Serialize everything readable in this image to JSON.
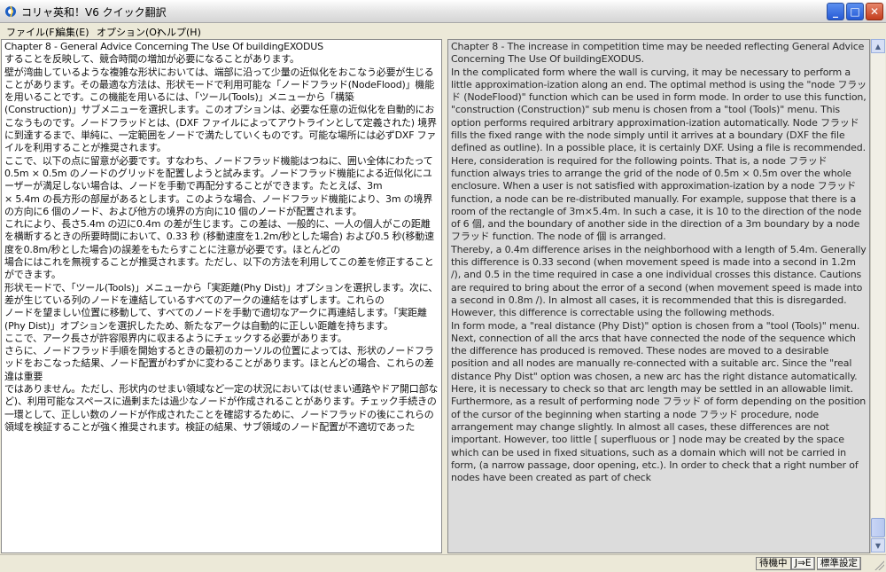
{
  "window": {
    "title": "コリャ英和！V6 クイック翻訳",
    "minimize_label": "_",
    "maximize_label": "□",
    "close_label": "✕"
  },
  "menu": [
    {
      "label": "ファイル(F)"
    },
    {
      "label": "編集(E)"
    },
    {
      "label": "オプション(O)"
    },
    {
      "label": "ヘルプ(H)"
    }
  ],
  "translation_pane": {
    "paragraphs": [
      "Chapter 8 - General Advice Concerning The Use Of buildingEXODUS",
      "することを反映して、競合時間の増加が必要になることがあります。",
      "壁が湾曲しているような複雑な形状においては、端部に沿って少量の近似化をおこなう必要が生じることがあります。その最適な方法は、形状モードで利用可能な「ノードフラッド(NodeFlood)」機能を用いることです。この機能を用いるには、「ツール(Tools)」メニューから「構築",
      "(Construction)」サブメニューを選択します。このオプションは、必要な任意の近似化を自動的におこなうものです。ノードフラッドとは、(DXF ファイルによってアウトラインとして定義された) 境界に到達するまで、単純に、一定範囲をノードで満たしていくものです。可能な場所には必ずDXF ファイルを利用することが推奨されます。",
      "ここで、以下の点に留意が必要です。すなわち、ノードフラッド機能はつねに、囲い全体にわたって0.5m × 0.5m のノードのグリッドを配置しようと試みます。ノードフラッド機能による近似化にユーザーが満足しない場合は、ノードを手動で再配分することができます。たとえば、3m",
      "× 5.4m の長方形の部屋があるとします。このような場合、ノードフラッド機能により、3m の境界の方向に6 個のノード、および他方の境界の方向に10 個のノードが配置されます。",
      "これにより、長さ5.4m の辺に0.4m の差が生じます。この差は、一般的に、一人の個人がこの距離を横断するときの所要時間において、0.33 秒 (移動速度を1.2m/秒とした場合) および0.5 秒(移動速度を0.8m/秒とした場合)の誤差をもたらすことに注意が必要です。ほとんどの",
      "場合にはこれを無視することが推奨されます。ただし、以下の方法を利用してこの差を修正することができます。",
      "形状モードで、「ツール(Tools)」メニューから「実距離(Phy Dist)」オプションを選択します。次に、差が生じている列のノードを連結しているすべてのアークの連結をはずします。これらの",
      "ノードを望ましい位置に移動して、すべてのノードを手動で適切なアークに再連結します。「実距離(Phy Dist)」オプションを選択したため、新たなアークは自動的に正しい距離を持ちます。",
      "ここで、アーク長さが許容限界内に収まるようにチェックする必要があります。",
      "さらに、ノードフラッド手順を開始するときの最初のカーソルの位置によっては、形状のノードフラッドをおこなった結果、ノード配置がわずかに変わることがあります。ほとんどの場合、これらの差違は重要",
      "ではありません。ただし、形状内のせまい領域など一定の状況においては(せまい通路やドア開口部など)、利用可能なスペースに過剰または過少なノードが作成されることがあります。チェック手続きの",
      "一環として、正しい数のノードが作成されたことを確認するために、ノードフラッドの後にこれらの領域を検証することが強く推奨されます。検証の結果、サブ領域のノード配置が不適切であった"
    ]
  },
  "source_pane": {
    "paragraphs": [
      "Chapter 8 - The increase in competition time may be needed reflecting General Advice Concerning The Use Of buildingEXODUS.",
      "In the complicated form where the wall is curving, it may be necessary to perform a little approximation-ization along an end. The optimal method is using the \"node フラッド (NodeFlood)\" function which can be used in form mode. In order to use this function, \"construction (Construction)\" sub menu is chosen from a \"tool (Tools)\" menu. This option performs required arbitrary approximation-ization automatically. Node フラッド fills the fixed range with the node simply until it arrives at a boundary (DXF the file defined as outline). In a possible place, it is certainly DXF. Using a file is recommended.",
      "Here, consideration is required for the following points. That is, a node フラッド function always tries to arrange the grid of the node of 0.5m × 0.5m over the whole enclosure. When a user is not satisfied with approximation-ization by a node フラッド function, a node can be re-distributed manually. For example, suppose that there is a room of the rectangle of 3m×5.4m. In such a case, it is 10 to the direction of the node of 6 個, and the boundary of another side in the direction of a 3m boundary by a node フラッド function. The node of 個 is arranged.",
      "Thereby, a 0.4m difference arises in the neighborhood with a length of 5.4m. Generally this difference is 0.33 second (when movement speed is made into a second in 1.2m /), and 0.5 in the time required in case a one individual crosses this distance. Cautions are required to bring about the error of a second (when movement speed is made into a second in 0.8m /). In almost all cases, it is recommended that this is disregarded. However, this difference is correctable using the following methods.",
      "In form mode, a \"real distance (Phy Dist)\" option is chosen from a \"tool (Tools)\" menu. Next, connection of all the arcs that have connected the node of the sequence which the difference has produced is removed. These nodes are moved to a desirable position and all nodes are manually re-connected with a suitable arc. Since the \"real distance Phy Dist\" option was chosen, a new arc has the right distance automatically.",
      "Here, it is necessary to check so that arc length may be settled in an allowable limit.",
      "Furthermore, as a result of performing node フラッド of form depending on the position of the cursor of the beginning when starting a node フラッド procedure, node arrangement may change slightly. In almost all cases, these differences are not important. However, too little [ superfluous or ] node may be created by the space which can be used in fixed situations, such as a domain which will not be carried in form, (a narrow passage, door opening, etc.). In order to check that a right number of nodes have been created as part of check"
    ]
  },
  "statusbar": {
    "status": "待機中",
    "direction": "J⇒E",
    "settings": "標準設定"
  }
}
